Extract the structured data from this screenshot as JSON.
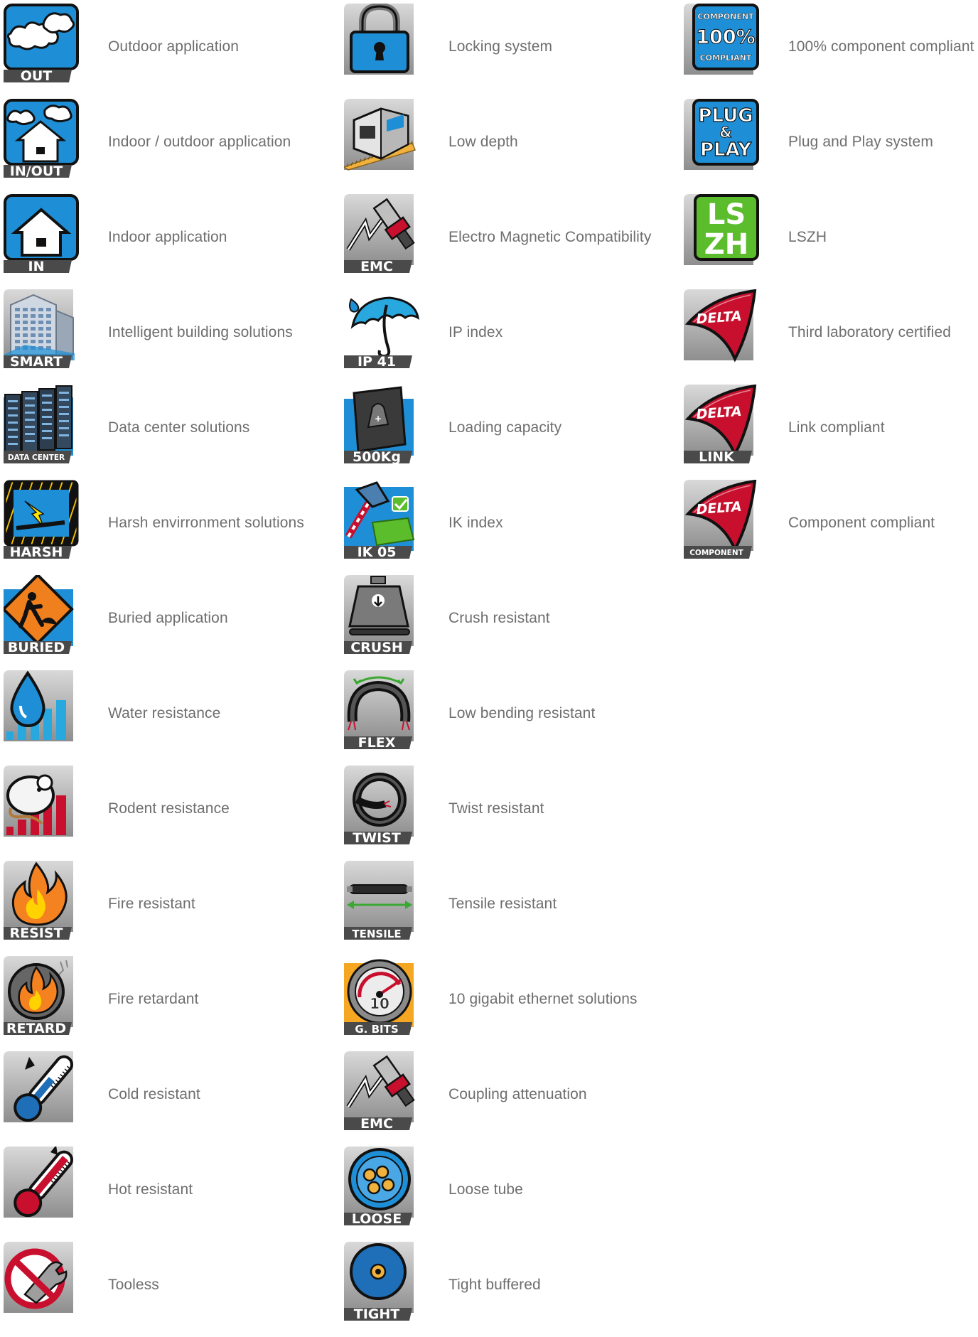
{
  "colors": {
    "blue": "#1e8fd6",
    "dark": "#333333",
    "grey": "#a8a8a8",
    "red": "#c8102e",
    "green": "#5bbd2b",
    "orange": "#f07f1e",
    "badge": "#4a4a4a"
  },
  "columns": [
    {
      "items": [
        {
          "id": "out",
          "icon": "cloud-sky-icon",
          "badge": "OUT",
          "label": "Outdoor application"
        },
        {
          "id": "inout",
          "icon": "house-cloud-icon",
          "badge": "IN/OUT",
          "label": "Indoor / outdoor application"
        },
        {
          "id": "in",
          "icon": "house-icon",
          "badge": "IN",
          "label": "Indoor application"
        },
        {
          "id": "smart",
          "icon": "building-icon",
          "badge": "SMART",
          "label": "Intelligent building solutions"
        },
        {
          "id": "datacenter",
          "icon": "server-rack-icon",
          "badge": "DATA CENTER",
          "label": "Data center solutions"
        },
        {
          "id": "harsh",
          "icon": "hazard-lightning-icon",
          "badge": "HARSH",
          "label": "Harsh envirronment solutions"
        },
        {
          "id": "buried",
          "icon": "roadwork-sign-icon",
          "badge": "BURIED",
          "label": "Buried application"
        },
        {
          "id": "water",
          "icon": "water-drop-icon",
          "badge": "",
          "label": "Water resistance"
        },
        {
          "id": "rodent",
          "icon": "rodent-icon",
          "badge": "",
          "label": "Rodent resistance"
        },
        {
          "id": "fire-resist",
          "icon": "flame-icon",
          "badge": "RESIST",
          "label": "Fire resistant"
        },
        {
          "id": "fire-retard",
          "icon": "fire-retard-icon",
          "badge": "RETARD",
          "label": "Fire retardant"
        },
        {
          "id": "cold",
          "icon": "thermometer-cold-icon",
          "badge": "",
          "label": "Cold resistant"
        },
        {
          "id": "hot",
          "icon": "thermometer-hot-icon",
          "badge": "",
          "label": "Hot resistant"
        },
        {
          "id": "tooless",
          "icon": "no-tool-icon",
          "badge": "",
          "label": "Tooless"
        }
      ]
    },
    {
      "items": [
        {
          "id": "lock",
          "icon": "padlock-icon",
          "badge": "",
          "label": "Locking system"
        },
        {
          "id": "lowdepth",
          "icon": "keystone-ruler-icon",
          "badge": "",
          "label": "Low depth"
        },
        {
          "id": "emc",
          "icon": "emc-plug-icon",
          "badge": "EMC",
          "label": "Electro  Magnetic Compatibility"
        },
        {
          "id": "ip",
          "icon": "umbrella-icon",
          "badge": "IP 41",
          "label": "IP index"
        },
        {
          "id": "load",
          "icon": "weight-box-icon",
          "badge": "500Kg",
          "label": "Loading capacity"
        },
        {
          "id": "ik",
          "icon": "hammer-icon",
          "badge": "IK 05",
          "label": "IK index"
        },
        {
          "id": "crush",
          "icon": "crush-weight-icon",
          "badge": "CRUSH",
          "label": "Crush resistant"
        },
        {
          "id": "flex",
          "icon": "bent-cable-icon",
          "badge": "FLEX",
          "label": "Low bending resistant"
        },
        {
          "id": "twist",
          "icon": "twisted-cable-icon",
          "badge": "TWIST",
          "label": "Twist resistant"
        },
        {
          "id": "tensile",
          "icon": "tensile-cable-icon",
          "badge": "TENSILE",
          "label": "Tensile resistant"
        },
        {
          "id": "gbits",
          "icon": "speedometer-icon",
          "badge": "G. BITS",
          "label": "10 gigabit ethernet solutions"
        },
        {
          "id": "coupling",
          "icon": "emc-plug-icon",
          "badge": "EMC",
          "label": "Coupling attenuation"
        },
        {
          "id": "loose",
          "icon": "loose-tube-icon",
          "badge": "LOOSE",
          "label": "Loose tube"
        },
        {
          "id": "tight",
          "icon": "tight-buffer-icon",
          "badge": "TIGHT",
          "label": "Tight buffered"
        }
      ]
    },
    {
      "items": [
        {
          "id": "comp100",
          "icon": "component-100-icon",
          "badge": "",
          "label": "100% component compliant",
          "icon_text": [
            "COMPONENT",
            "100%",
            "COMPLIANT"
          ]
        },
        {
          "id": "pnp",
          "icon": "plug-play-icon",
          "badge": "",
          "label": "Plug and Play system",
          "icon_text": [
            "PLUG",
            "&",
            "PLAY"
          ]
        },
        {
          "id": "lszh",
          "icon": "lszh-icon",
          "badge": "",
          "label": "LSZH",
          "icon_text": [
            "LS",
            "ZH"
          ]
        },
        {
          "id": "delta",
          "icon": "delta-icon",
          "badge": "",
          "label": "Third laboratory certified",
          "icon_text": [
            "DELTA"
          ]
        },
        {
          "id": "delta-link",
          "icon": "delta-icon",
          "badge": "LINK",
          "label": "Link compliant",
          "icon_text": [
            "DELTA"
          ]
        },
        {
          "id": "delta-comp",
          "icon": "delta-icon",
          "badge": "COMPONENT",
          "label": "Component compliant",
          "icon_text": [
            "DELTA"
          ]
        }
      ]
    }
  ]
}
